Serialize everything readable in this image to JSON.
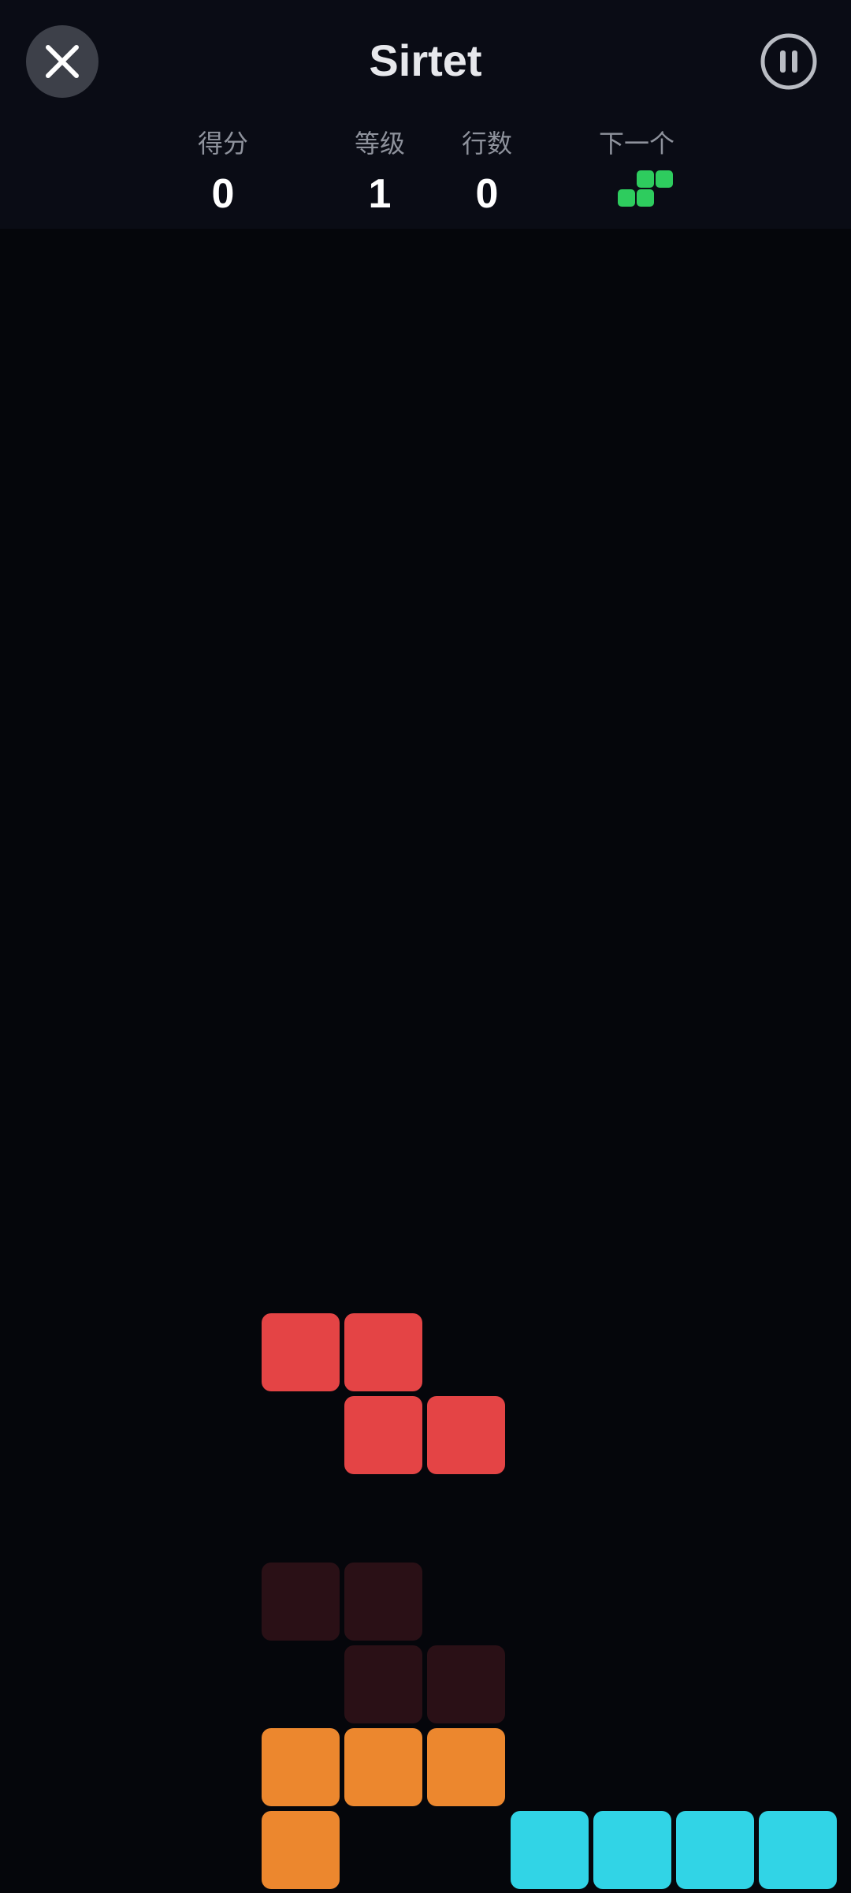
{
  "header": {
    "title": "Sirtet",
    "close_icon": "close-icon",
    "pause_icon": "pause-icon"
  },
  "stats": {
    "score_label": "得分",
    "score_value": "0",
    "level_label": "等级",
    "level_value": "1",
    "lines_label": "行数",
    "lines_value": "0",
    "next_label": "下一个",
    "next_piece": "S",
    "next_piece_color": "#2ecc5e"
  },
  "board": {
    "background": "#05060b",
    "active_piece": {
      "type": "Z",
      "color": "#e44445"
    },
    "ghost_piece": {
      "type": "Z",
      "color": "#2a1016"
    },
    "locked_pieces": [
      {
        "type": "L",
        "color": "#ec872e"
      },
      {
        "type": "I",
        "color": "#31d4e6"
      }
    ]
  }
}
